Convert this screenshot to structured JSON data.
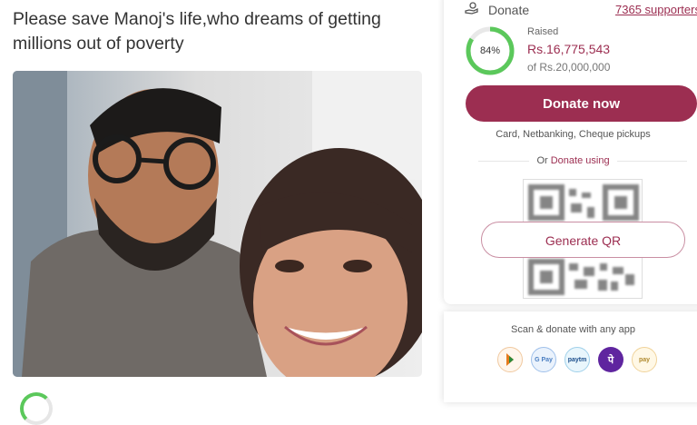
{
  "campaign": {
    "title": "Please save Manoj's life,who dreams of getting millions out of poverty"
  },
  "photo": {
    "icon": "photo-of-couple"
  },
  "donate_panel": {
    "label": "Donate",
    "supporters": "7365 supporters",
    "percent_text": "84%",
    "percent_value": 0.84,
    "raised_label": "Raised",
    "raised_amount": "Rs.16,775,543",
    "goal": "of Rs.20,000,000",
    "donate_button": "Donate now",
    "methods": "Card, Netbanking, Cheque pickups",
    "or_prefix": "Or",
    "or_link": "Donate using",
    "generate_qr": "Generate QR",
    "scan_text": "Scan & donate with any app",
    "apps": [
      {
        "name": "bhim",
        "label": ""
      },
      {
        "name": "gpay",
        "label": "G Pay"
      },
      {
        "name": "paytm",
        "label": "paytm"
      },
      {
        "name": "phonepe",
        "label": "पे"
      },
      {
        "name": "other-upi",
        "label": "pay"
      }
    ]
  },
  "colors": {
    "accent": "#9c2e51",
    "progress": "#5bc85b"
  }
}
